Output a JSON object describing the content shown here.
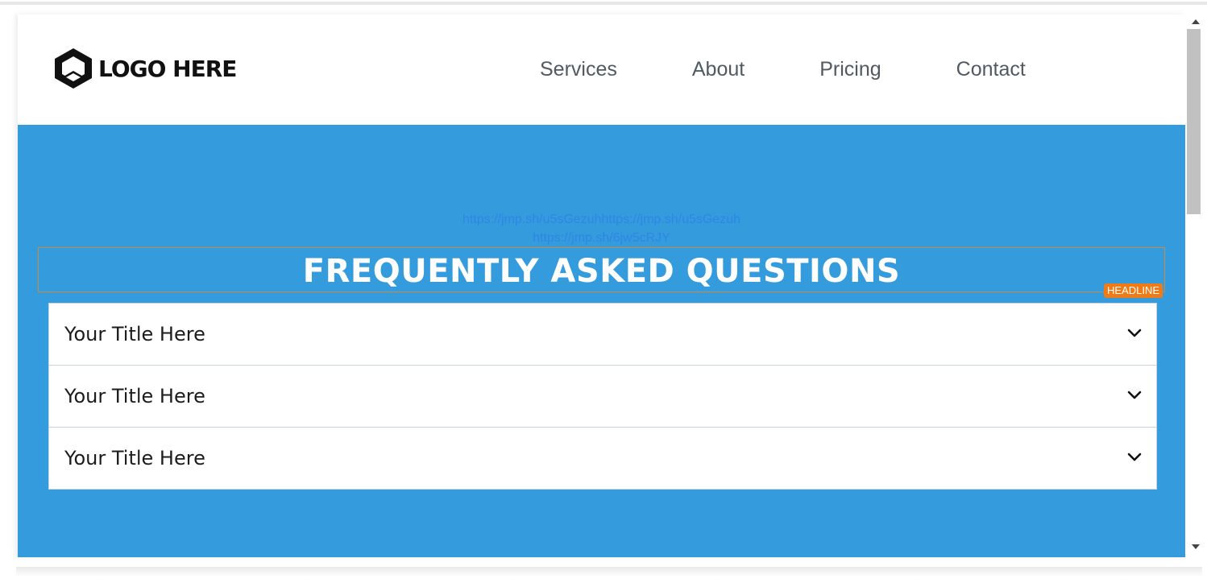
{
  "header": {
    "logo_text": "LOGO HERE",
    "logo_icon": "hexagon-logo-icon",
    "nav": [
      {
        "label": "Services"
      },
      {
        "label": "About"
      },
      {
        "label": "Pricing"
      },
      {
        "label": "Contact"
      }
    ]
  },
  "hero": {
    "background_color": "#349bdc",
    "links": [
      "https://jmp.sh/u5sGezuhhttps://jmp.sh/u5sGezuh",
      "https://jmp.sh/6jw5cRJY"
    ],
    "headline": "FREQUENTLY ASKED QUESTIONS",
    "headline_badge": "HEADLINE"
  },
  "faq": {
    "items": [
      {
        "title": "Your Title Here",
        "icon": "chevron-down-icon"
      },
      {
        "title": "Your Title Here",
        "icon": "chevron-down-icon"
      },
      {
        "title": "Your Title Here",
        "icon": "chevron-down-icon"
      }
    ]
  },
  "colors": {
    "accent": "#349bdc",
    "badge": "#f07b16",
    "link": "#2f86e6"
  }
}
